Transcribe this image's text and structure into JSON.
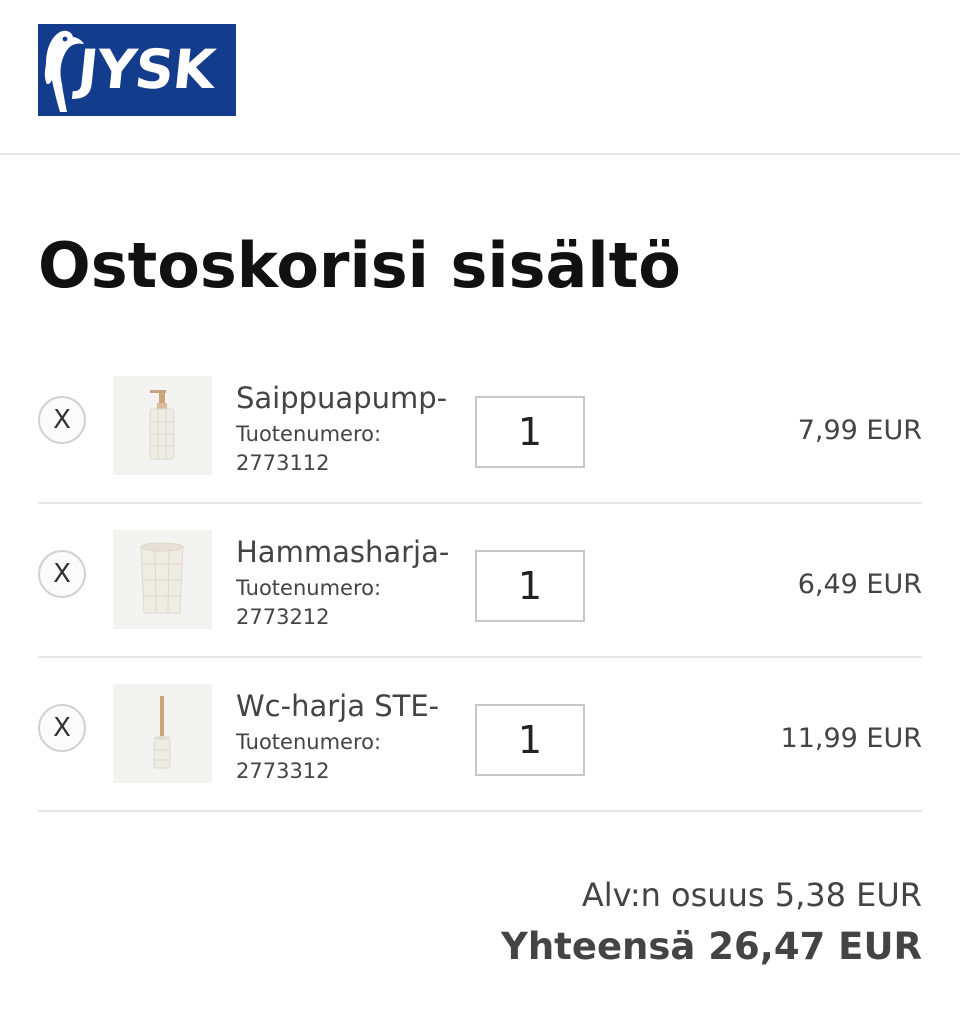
{
  "header": {
    "logo_text": "JYSK",
    "brand_color": "#143c8c"
  },
  "page": {
    "title": "Ostoskorisi sisältö"
  },
  "cart": {
    "remove_label": "X",
    "sku_label": "Tuotenumero:",
    "items": [
      {
        "name": "Saippuapump-",
        "sku": "2773112",
        "quantity": "1",
        "price": "7,99 EUR",
        "image_icon": "soap-dispenser-icon"
      },
      {
        "name": "Hammasharja-",
        "sku": "2773212",
        "quantity": "1",
        "price": "6,49 EUR",
        "image_icon": "toothbrush-cup-icon"
      },
      {
        "name": "Wc-harja STE-",
        "sku": "2773312",
        "quantity": "1",
        "price": "11,99 EUR",
        "image_icon": "toilet-brush-icon"
      }
    ]
  },
  "summary": {
    "vat_text": "Alv:n osuus 5,38 EUR",
    "total_text": "Yhteensä 26,47 EUR"
  }
}
